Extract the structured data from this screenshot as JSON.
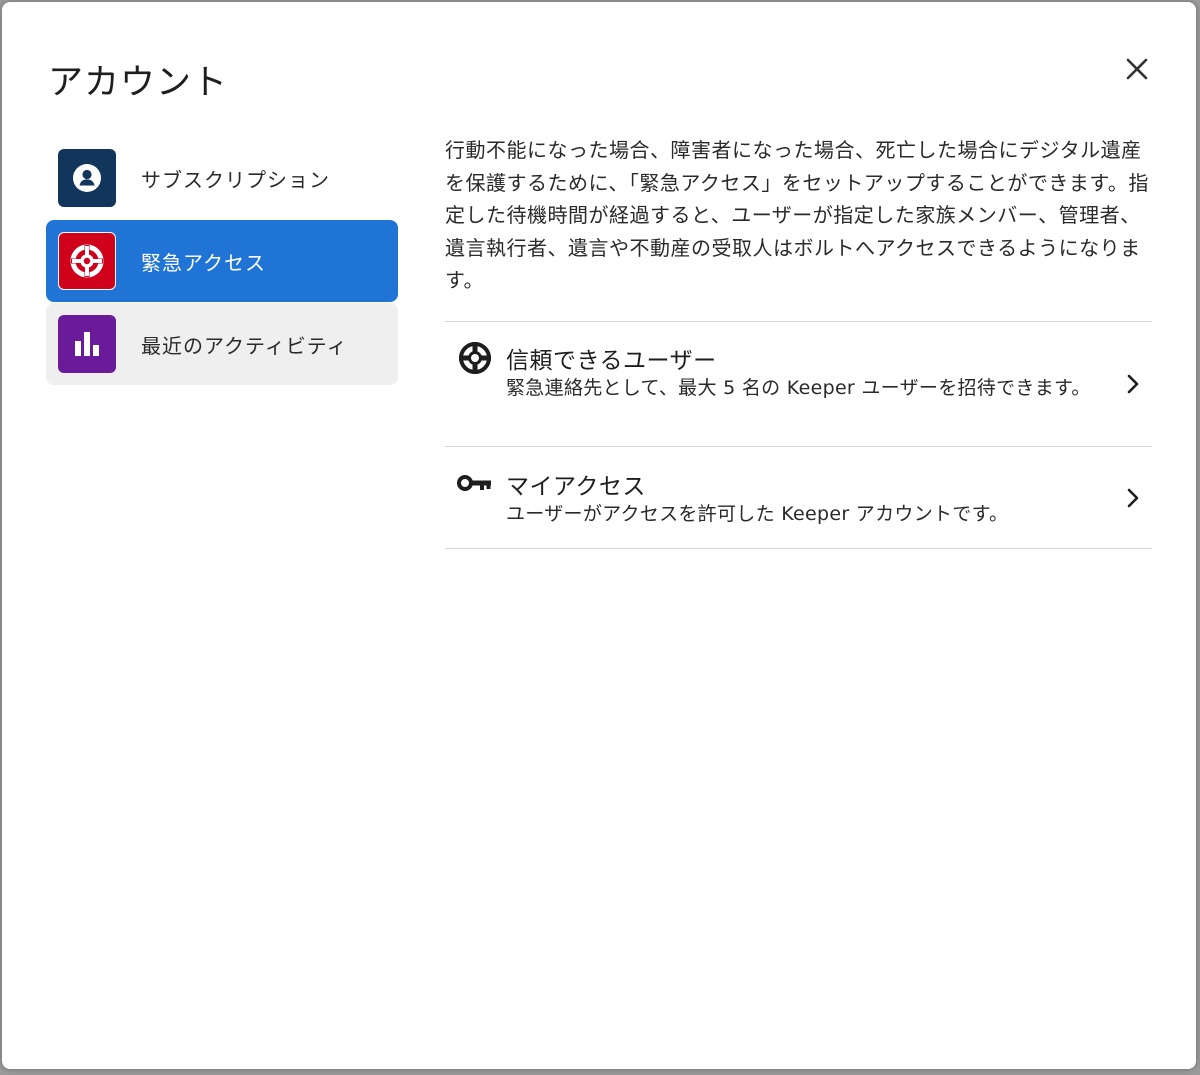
{
  "dialog": {
    "title": "アカウント",
    "close_label": "×"
  },
  "sidebar": {
    "items": [
      {
        "label": "サブスクリプション",
        "icon": "user-circle-icon",
        "icon_bg": "#12355b",
        "state": "normal"
      },
      {
        "label": "緊急アクセス",
        "icon": "lifebuoy-icon",
        "icon_bg": "#d0021b",
        "state": "selected"
      },
      {
        "label": "最近のアクティビティ",
        "icon": "bar-chart-icon",
        "icon_bg": "#6a1b9a",
        "state": "hover"
      }
    ]
  },
  "main": {
    "description": "行動不能になった場合、障害者になった場合、死亡した場合にデジタル遺産を保護するために、「緊急アクセス」をセットアップすることができます。指定した待機時間が経過すると、ユーザーが指定した家族メンバー、管理者、遺言執行者、遺言や不動産の受取人はボルトへアクセスできるようになります。",
    "options": [
      {
        "title": "信頼できるユーザー",
        "description": "緊急連絡先として、最大 5 名の Keeper ユーザーを招待できます。",
        "icon": "lifebuoy-icon"
      },
      {
        "title": "マイアクセス",
        "description": "ユーザーがアクセスを許可した Keeper アカウントです。",
        "icon": "key-icon"
      }
    ]
  },
  "colors": {
    "accent": "#1f74d6",
    "subscription_icon_bg": "#12355b",
    "emergency_icon_bg": "#d0021b",
    "activity_icon_bg": "#6a1b9a"
  }
}
